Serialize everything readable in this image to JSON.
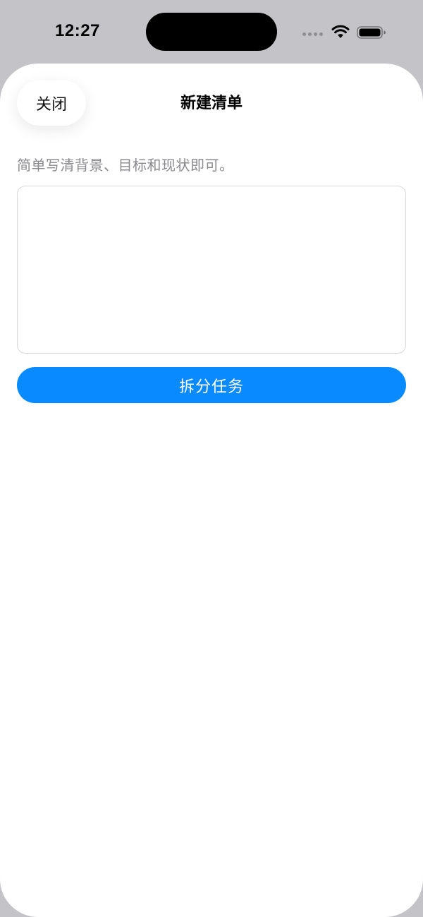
{
  "status_bar": {
    "time": "12:27",
    "icons": [
      "cellular-signal-icon",
      "wifi-icon",
      "battery-icon"
    ]
  },
  "sheet": {
    "title": "新建清单",
    "close_label": "关闭",
    "hint": "简单写清背景、目标和现状即可。",
    "input": {
      "value": "",
      "placeholder": ""
    },
    "submit_label": "拆分任务"
  },
  "colors": {
    "accent": "#0a8aff",
    "hint_text": "#8a8a8e",
    "backdrop": "#c3c3c8"
  }
}
